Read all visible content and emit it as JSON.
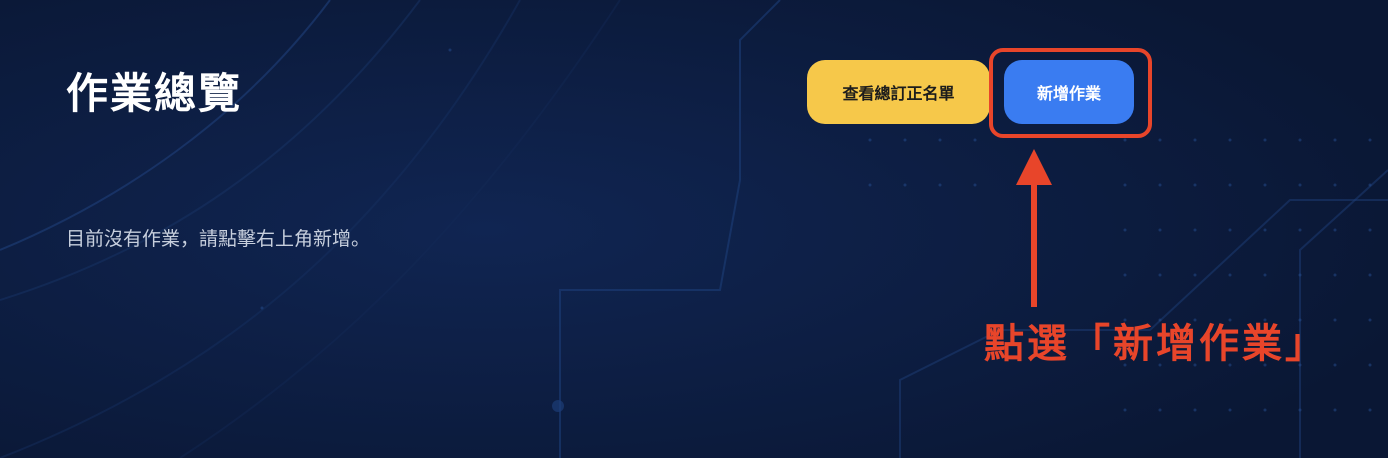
{
  "header": {
    "title": "作業總覽"
  },
  "toolbar": {
    "roster_button_label": "查看總訂正名單",
    "add_button_label": "新增作業"
  },
  "main": {
    "empty_message": "目前沒有作業，請點擊右上角新增。"
  },
  "annotation": {
    "callout_text": "點選「新增作業」",
    "arrow_icon": "arrow-up-icon"
  },
  "colors": {
    "background": "#0b1a3a",
    "roster_button": "#f6c84a",
    "add_button": "#3a7cf1",
    "annotation": "#e8452a"
  }
}
